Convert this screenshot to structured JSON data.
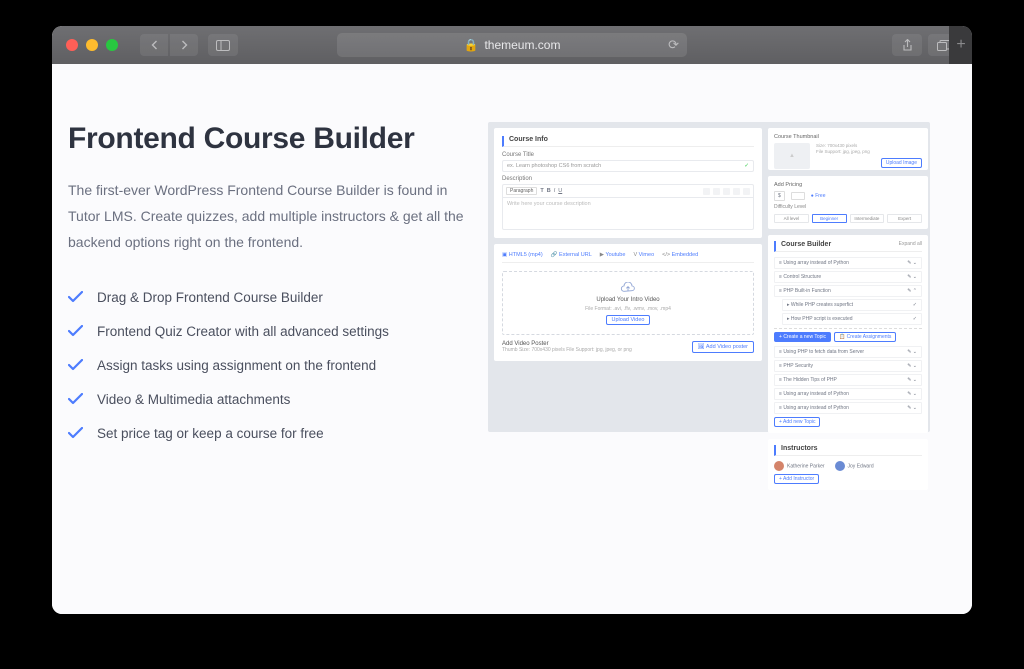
{
  "browser": {
    "domain": "themeum.com",
    "lock_icon": "🔒"
  },
  "page": {
    "heading": "Frontend Course Builder",
    "description": "The first-ever WordPress Frontend Course Builder is found in Tutor LMS. Create quizzes, add multiple instructors & get all the backend options right on the frontend.",
    "features": [
      "Drag & Drop Frontend Course Builder",
      "Frontend Quiz Creator with all advanced settings",
      "Assign tasks using assignment on the frontend",
      "Video & Multimedia attachments",
      "Set price tag or keep a course for free"
    ]
  },
  "mock": {
    "course_info": {
      "section": "Course Info",
      "title_label": "Course Title",
      "title_placeholder": "ex. Learn photoshop CS6 from scratch",
      "desc_label": "Description",
      "paragraph": "Paragraph",
      "desc_placeholder": "Write here your course description"
    },
    "video": {
      "tabs": [
        "HTML5 (mp4)",
        "External URL",
        "Youtube",
        "Vimeo",
        "Embedded"
      ],
      "upload_heading": "Upload Your Intro Video",
      "formats": "File Format:  .avi, .flv, .wmv, .mov, .mp4",
      "upload_btn": "Upload Video",
      "poster_label": "Add Video Poster",
      "poster_hint": "Thumb Size: 700x430 pixels File Support: jpg, jpeg, or png",
      "poster_btn": "Add Video poster"
    },
    "thumbnail": {
      "section": "Course Thumbnail",
      "upload_btn": "Upload Image"
    },
    "pricing": {
      "section": "Add Pricing",
      "price": "$",
      "free": "Free",
      "diff_label": "Difficulty Level",
      "levels": [
        "All level",
        "Beginner",
        "Intermediate",
        "Expert"
      ]
    },
    "builder": {
      "section": "Course Builder",
      "expand": "Expand all",
      "rows": [
        "Using array instead of Python",
        "Control Structure",
        "PHP Built-in Function",
        "While PHP creates superfict",
        "How PHP script is executed"
      ],
      "new_topic": "Create a new Topic",
      "assign": "Create Assignments",
      "rows2": [
        "Using PHP to fetch data from Server",
        "PHP Security",
        "The Hidden Tips of PHP",
        "Using array instead of Python",
        "Using array instead of Python"
      ],
      "add_topic": "Add new Topic"
    },
    "instructors": {
      "section": "Instructors",
      "names": [
        "Katherine Parker",
        "Joy Edward"
      ],
      "add": "Add Instructor"
    }
  }
}
